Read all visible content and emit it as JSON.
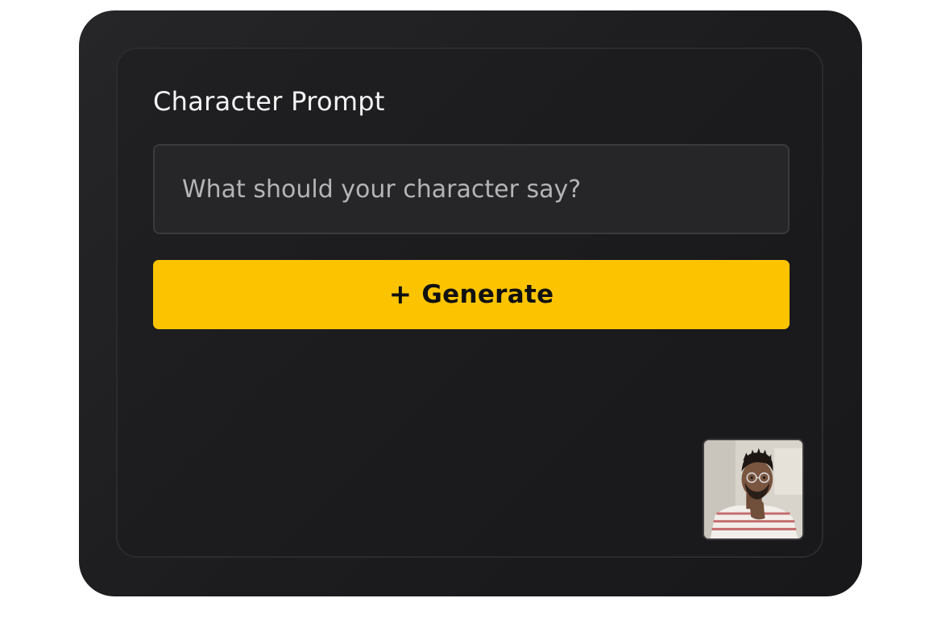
{
  "card": {
    "title": "Character Prompt",
    "input": {
      "value": "",
      "placeholder": "What should your character say?"
    },
    "generate_button": {
      "icon": "plus-icon",
      "plus_glyph": "+",
      "label": "Generate"
    },
    "avatar": {
      "icon": "character-avatar"
    }
  },
  "colors": {
    "accent": "#fcc400",
    "card_bg": "#1c1c1e",
    "panel_border": "#2b2b2e",
    "input_bg": "#262628",
    "title_text": "#f4f4f5",
    "placeholder_text": "#b4b4b8"
  }
}
